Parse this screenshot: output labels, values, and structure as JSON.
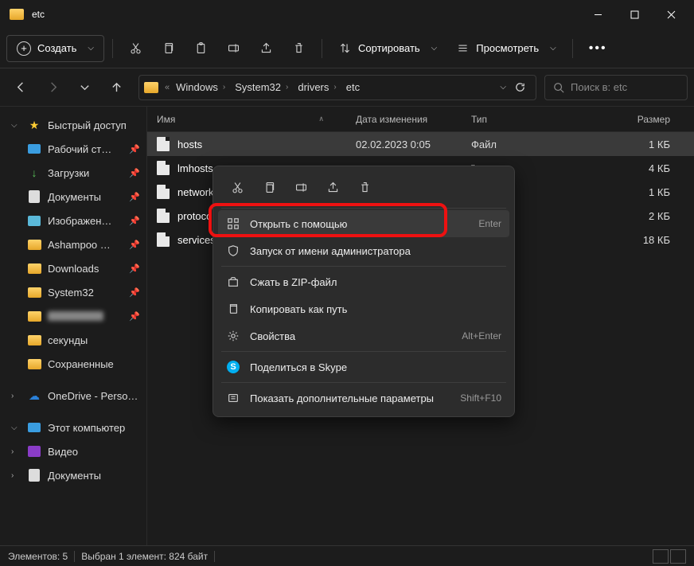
{
  "window": {
    "title": "etc"
  },
  "toolbar": {
    "create": "Создать",
    "sort": "Сортировать",
    "view": "Просмотреть"
  },
  "breadcrumb": [
    "Windows",
    "System32",
    "drivers",
    "etc"
  ],
  "search": {
    "placeholder": "Поиск в: etc"
  },
  "sidebar": {
    "quick": "Быстрый доступ",
    "desktop": "Рабочий ст…",
    "downloads": "Загрузки",
    "documents": "Документы",
    "pictures": "Изображен…",
    "ashampoo": "Ashampoo …",
    "dl2": "Downloads",
    "sys32": "System32",
    "seconds": "секунды",
    "saved": "Сохраненные",
    "onedrive": "OneDrive - Perso…",
    "thispc": "Этот компьютер",
    "video": "Видео",
    "documents2": "Документы"
  },
  "columns": {
    "name": "Имя",
    "date": "Дата изменения",
    "type": "Тип",
    "size": "Размер"
  },
  "files": [
    {
      "name": "hosts",
      "date": "02.02.2023 0:05",
      "type": "Файл",
      "size": "1 КБ"
    },
    {
      "name": "lmhosts.s",
      "date": "",
      "type": "\"",
      "size": "4 КБ"
    },
    {
      "name": "networks",
      "date": "",
      "type": "",
      "size": "1 КБ"
    },
    {
      "name": "protocol",
      "date": "",
      "type": "",
      "size": "2 КБ"
    },
    {
      "name": "services",
      "date": "",
      "type": "",
      "size": "18 КБ"
    }
  ],
  "context": {
    "open_with": "Открыть с помощью",
    "open_with_short": "Enter",
    "run_admin": "Запуск от имени администратора",
    "zip": "Сжать в ZIP-файл",
    "copy_path": "Копировать как путь",
    "properties": "Свойства",
    "properties_short": "Alt+Enter",
    "skype": "Поделиться в Skype",
    "more": "Показать дополнительные параметры",
    "more_short": "Shift+F10"
  },
  "status": {
    "count": "Элементов: 5",
    "selected": "Выбран 1 элемент: 824 байт"
  }
}
